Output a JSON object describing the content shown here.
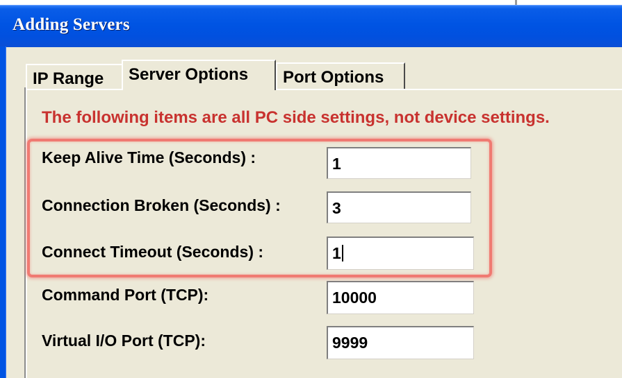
{
  "window": {
    "title": "Adding Servers"
  },
  "tabs": [
    {
      "label": "IP Range",
      "active": false
    },
    {
      "label": "Server Options",
      "active": true
    },
    {
      "label": "Port Options",
      "active": false
    }
  ],
  "notice": "The following items are all PC side settings, not device settings.",
  "settings": [
    {
      "label": "Keep Alive Time (Seconds) :",
      "value": "1"
    },
    {
      "label": "Connection Broken (Seconds) :",
      "value": "3"
    },
    {
      "label": "Connect Timeout (Seconds) :",
      "value": "1"
    },
    {
      "label": "Command Port (TCP):",
      "value": "10000"
    },
    {
      "label": "Virtual I/O Port (TCP):",
      "value": "9999"
    }
  ],
  "colors": {
    "titlebar": "#0054e3",
    "notice_text": "#c8322f",
    "highlight": "#f07a72",
    "dialog_bg": "#ece9d8"
  }
}
